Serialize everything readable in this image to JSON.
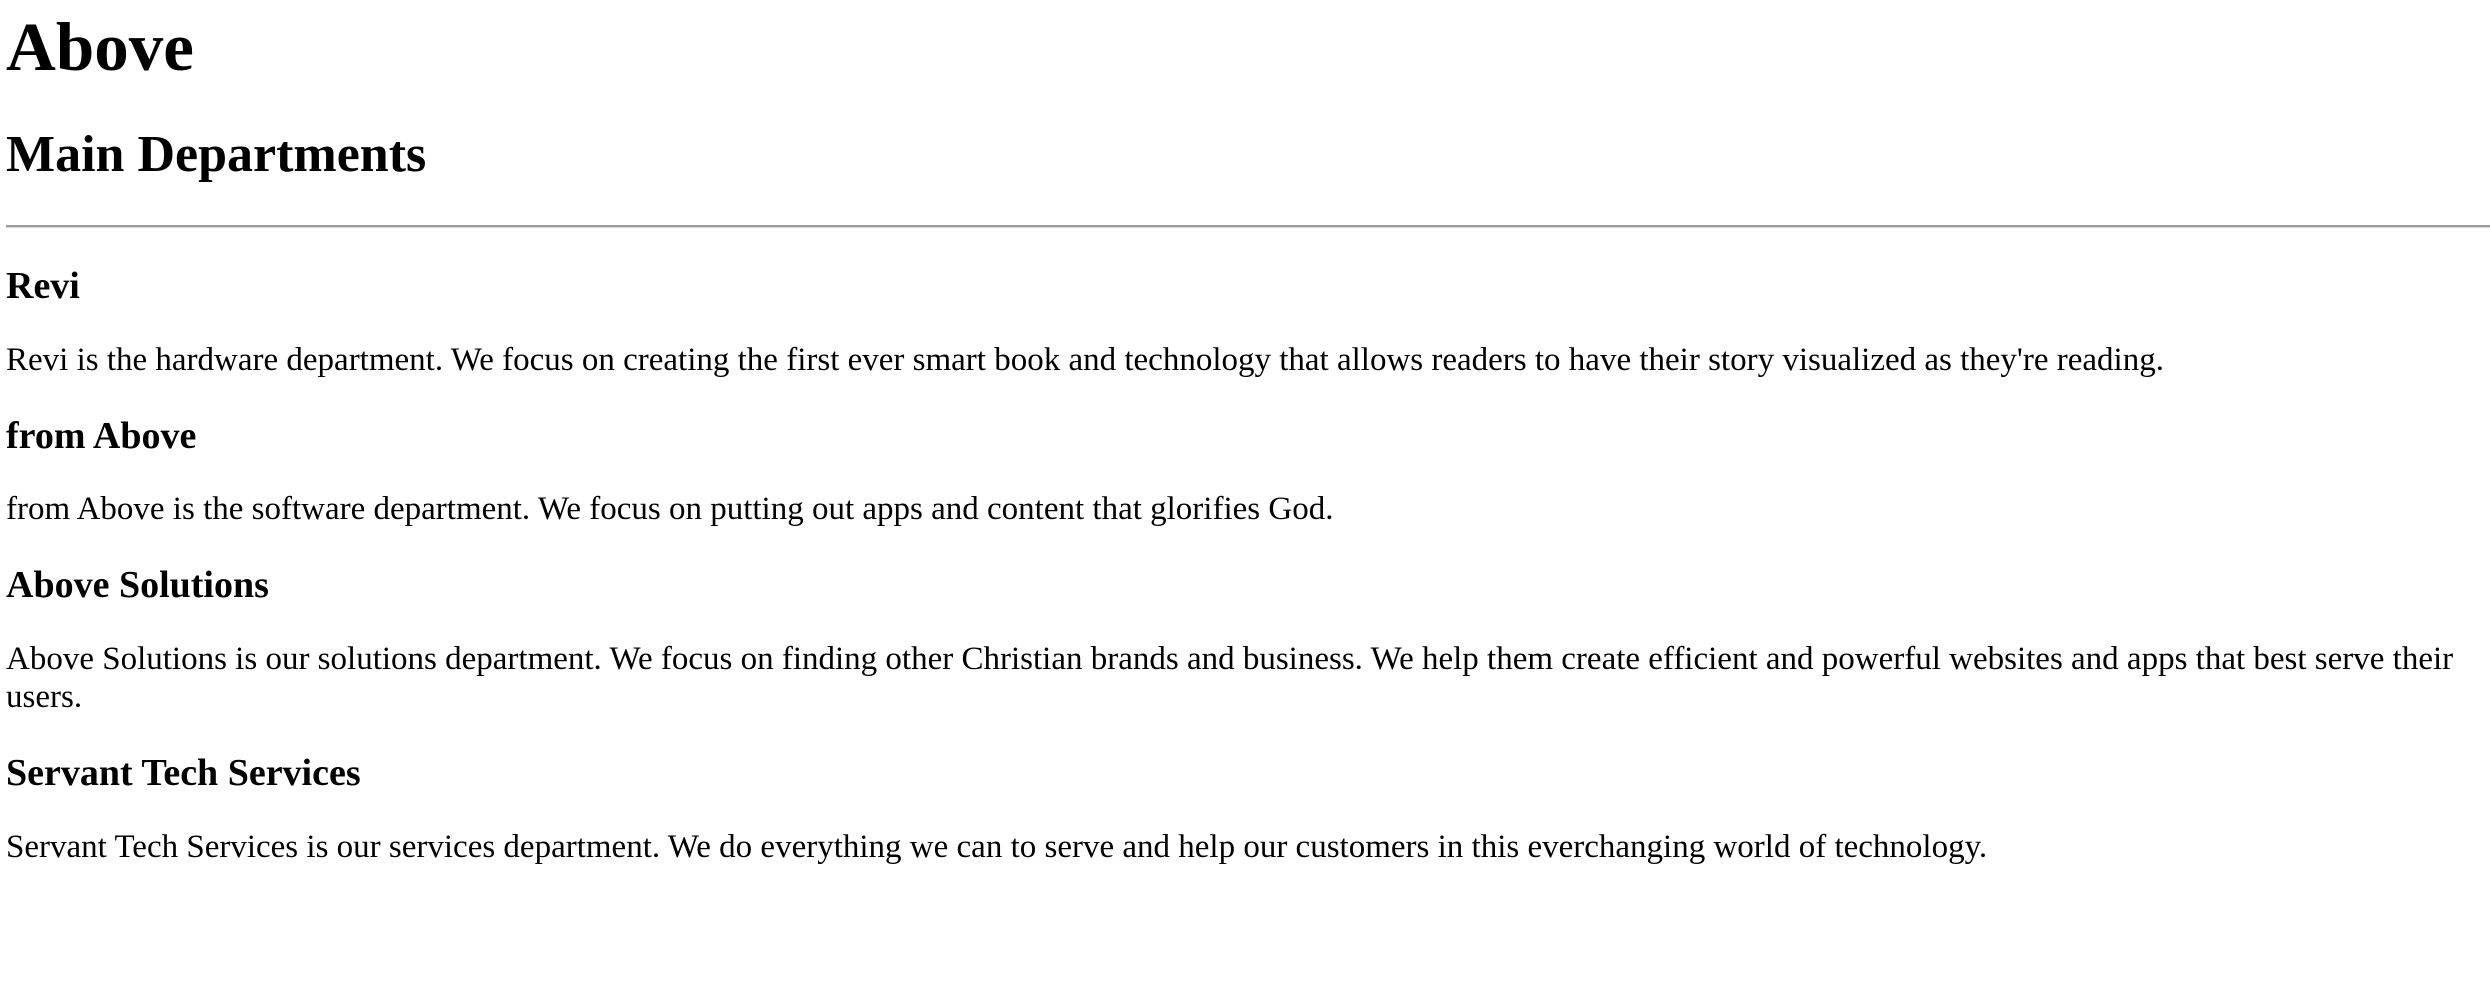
{
  "page": {
    "title": "Above",
    "subtitle": "Main Departments"
  },
  "departments": [
    {
      "name": "Revi",
      "description": "Revi is the hardware department. We focus on creating the first ever smart book and technology that allows readers to have their story visualized as they're reading."
    },
    {
      "name": "from Above",
      "description": "from Above is the software department. We focus on putting out apps and content that glorifies God."
    },
    {
      "name": "Above Solutions",
      "description": "Above Solutions is our solutions department. We focus on finding other Christian brands and business. We help them create efficient and powerful websites and apps that best serve their users."
    },
    {
      "name": "Servant Tech Services",
      "description": "Servant Tech Services is our services department. We do everything we can to serve and help our customers in this everchanging world of technology."
    }
  ]
}
